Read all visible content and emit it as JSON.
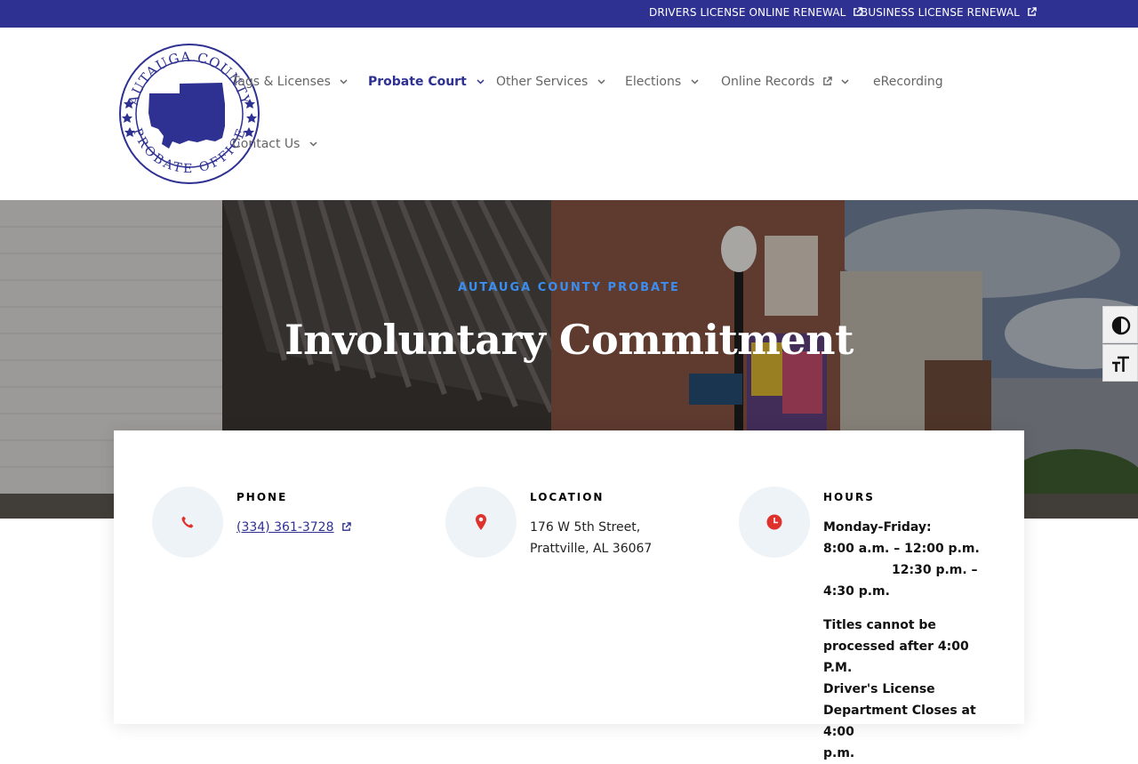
{
  "topbar": {
    "links": [
      {
        "label": "DRIVERS LICENSE ONLINE RENEWAL"
      },
      {
        "label": "BUSINESS LICENSE RENEWAL"
      }
    ]
  },
  "logo": {
    "ring_text_top": "AUTAUGA COUNTY",
    "ring_text_bottom": "PROBATE OFFICE"
  },
  "nav": {
    "items": [
      {
        "label": "Tags & Licenses"
      },
      {
        "label": "Probate Court"
      },
      {
        "label": "Other Services"
      },
      {
        "label": "Elections"
      },
      {
        "label": "Online Records"
      },
      {
        "label": "eRecording"
      },
      {
        "label": "Contact Us"
      }
    ]
  },
  "hero": {
    "eyebrow": "AUTAUGA COUNTY PROBATE",
    "title": "Involuntary Commitment"
  },
  "info": {
    "phone": {
      "heading": "PHONE",
      "number": "(334) 361-3728"
    },
    "location": {
      "heading": "LOCATION",
      "line1": "176 W 5th Street,",
      "line2": "Prattville, AL 36067"
    },
    "hours": {
      "heading": "HOURS",
      "days": "Monday-Friday:",
      "slot1": "8:00 a.m. – 12:00 p.m.",
      "slot2a": "12:30 p.m. –",
      "slot2b": "4:30 p.m.",
      "note1": "Titles cannot be",
      "note2": "processed after 4:00 P.M.",
      "note3": "Driver's License",
      "note4": "Department Closes at 4:00",
      "note5": "p.m."
    }
  },
  "colors": {
    "brand": "#2e3192",
    "accent_red": "#e0322c",
    "eyebrow_blue": "#3b8ef0"
  },
  "icons": {
    "phone": "phone-icon",
    "location": "map-pin-icon",
    "hours": "clock-icon",
    "external": "external-link-icon",
    "chevron": "chevron-down-icon",
    "contrast": "contrast-icon",
    "font_size": "font-size-icon"
  }
}
